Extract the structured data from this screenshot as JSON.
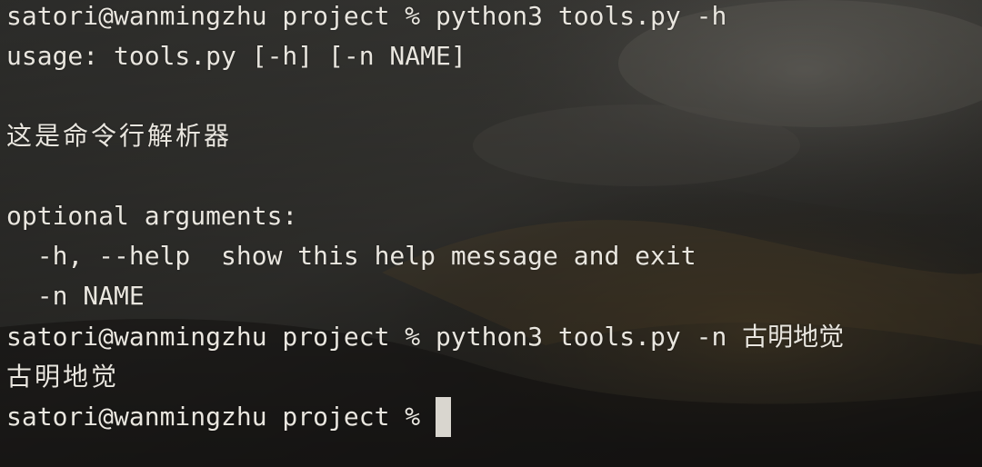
{
  "terminal": {
    "lines": [
      "satori@wanmingzhu project % python3 tools.py -h",
      "usage: tools.py [-h] [-n NAME]",
      "",
      "这是命令行解析器",
      "",
      "optional arguments:",
      "  -h, --help  show this help message and exit",
      "  -n NAME",
      "satori@wanmingzhu project % python3 tools.py -n 古明地觉",
      "古明地觉"
    ],
    "prompt": "satori@wanmingzhu project %"
  },
  "colors": {
    "text": "#e9e6df",
    "cursor": "#d9d6cf",
    "background_dark": "#2b2a27"
  }
}
